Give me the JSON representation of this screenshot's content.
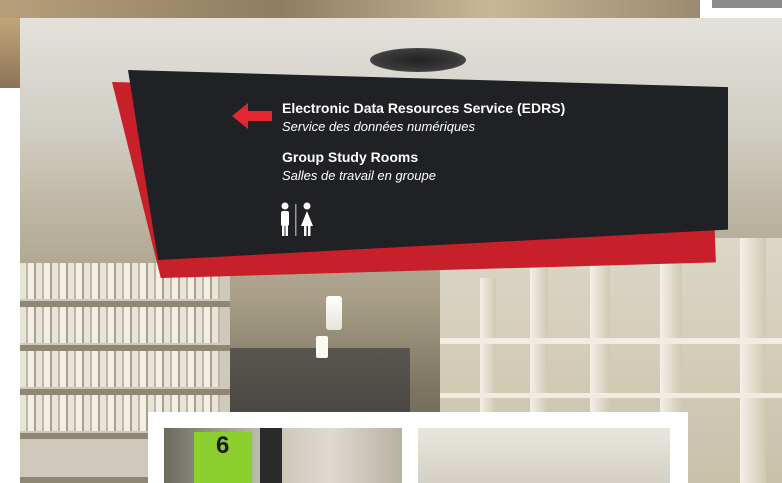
{
  "image": {
    "sign": {
      "line1_en": "Electronic Data Resources Service (EDRS)",
      "line1_fr": "Service des données numériques",
      "line2_en": "Group Study Rooms",
      "line2_fr": "Salles de travail en groupe",
      "arrow_direction": "left",
      "arrow_icon": "left-arrow-icon",
      "restroom_icon": "restroom-icon",
      "colors": {
        "panel": "#1f2124",
        "accent": "#c8202a",
        "text": "#ffffff"
      }
    },
    "inset": {
      "shelf_number": "6",
      "tag_color": "#8bcf2e"
    }
  }
}
